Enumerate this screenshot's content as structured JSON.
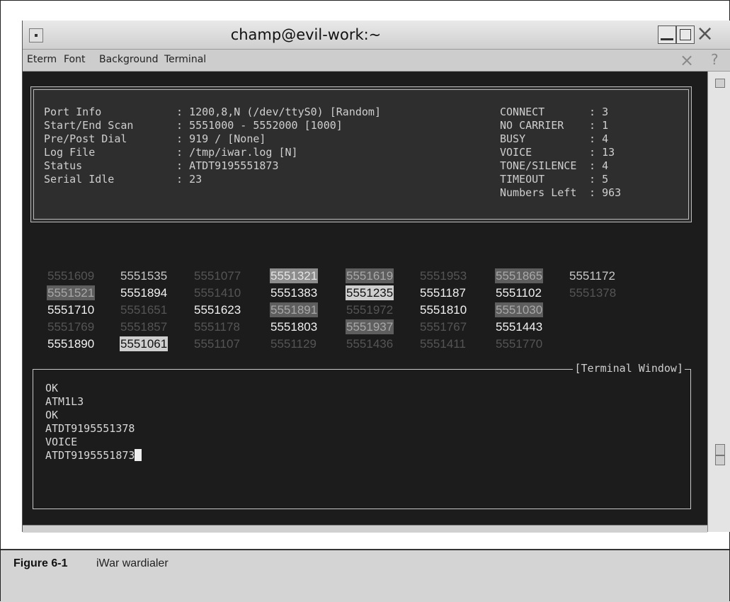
{
  "window": {
    "title": "champ@evil-work:~",
    "menu": [
      "Eterm",
      "Font",
      "Background",
      "Terminal"
    ],
    "menu_close_glyph": "×",
    "menu_help_glyph": "?"
  },
  "info": {
    "left": [
      {
        "label": "Port Info",
        "value": "1200,8,N (/dev/ttyS0) [Random]"
      },
      {
        "label": "Start/End Scan",
        "value": "5551000 - 5552000 [1000]"
      },
      {
        "label": "Pre/Post Dial",
        "value": "919 / [None]"
      },
      {
        "label": "Log File",
        "value": "/tmp/iwar.log [N]"
      },
      {
        "label": "Status",
        "value": "ATDT9195551873"
      },
      {
        "label": "Serial Idle",
        "value": "23"
      }
    ],
    "right": [
      {
        "label": "CONNECT",
        "value": "3"
      },
      {
        "label": "NO CARRIER",
        "value": "1"
      },
      {
        "label": "BUSY",
        "value": "4"
      },
      {
        "label": "VOICE",
        "value": "13"
      },
      {
        "label": "TONE/SILENCE",
        "value": "4"
      },
      {
        "label": "TIMEOUT",
        "value": "5"
      },
      {
        "label": "Numbers Left",
        "value": "963"
      }
    ]
  },
  "numbers": {
    "row1": [
      "5551609",
      "5551535",
      "5551077",
      "5551321",
      "5551619",
      "5551953",
      "5551865",
      "5551172"
    ],
    "row2": [
      "5551521",
      "5551894",
      "5551410",
      "5551383",
      "5551235",
      "5551187",
      "5551102",
      "5551378"
    ],
    "row3": [
      "5551710",
      "5551651",
      "5551623",
      "5551891",
      "5551972",
      "5551810",
      "5551030"
    ],
    "row4": [
      "5551769",
      "5551857",
      "5551178",
      "5551803",
      "5551937",
      "5551767",
      "5551443"
    ],
    "row5": [
      "5551890",
      "5551061",
      "5551107",
      "5551129",
      "5551436",
      "5551411",
      "5551770"
    ]
  },
  "terminal_window": {
    "label": "[Terminal Window]",
    "lines": [
      "OK",
      "ATM1L3",
      "OK",
      "ATDT9195551378",
      "VOICE",
      "ATDT9195551873"
    ]
  },
  "caption": {
    "label": "Figure 6-1",
    "text": "iWar wardialer"
  }
}
